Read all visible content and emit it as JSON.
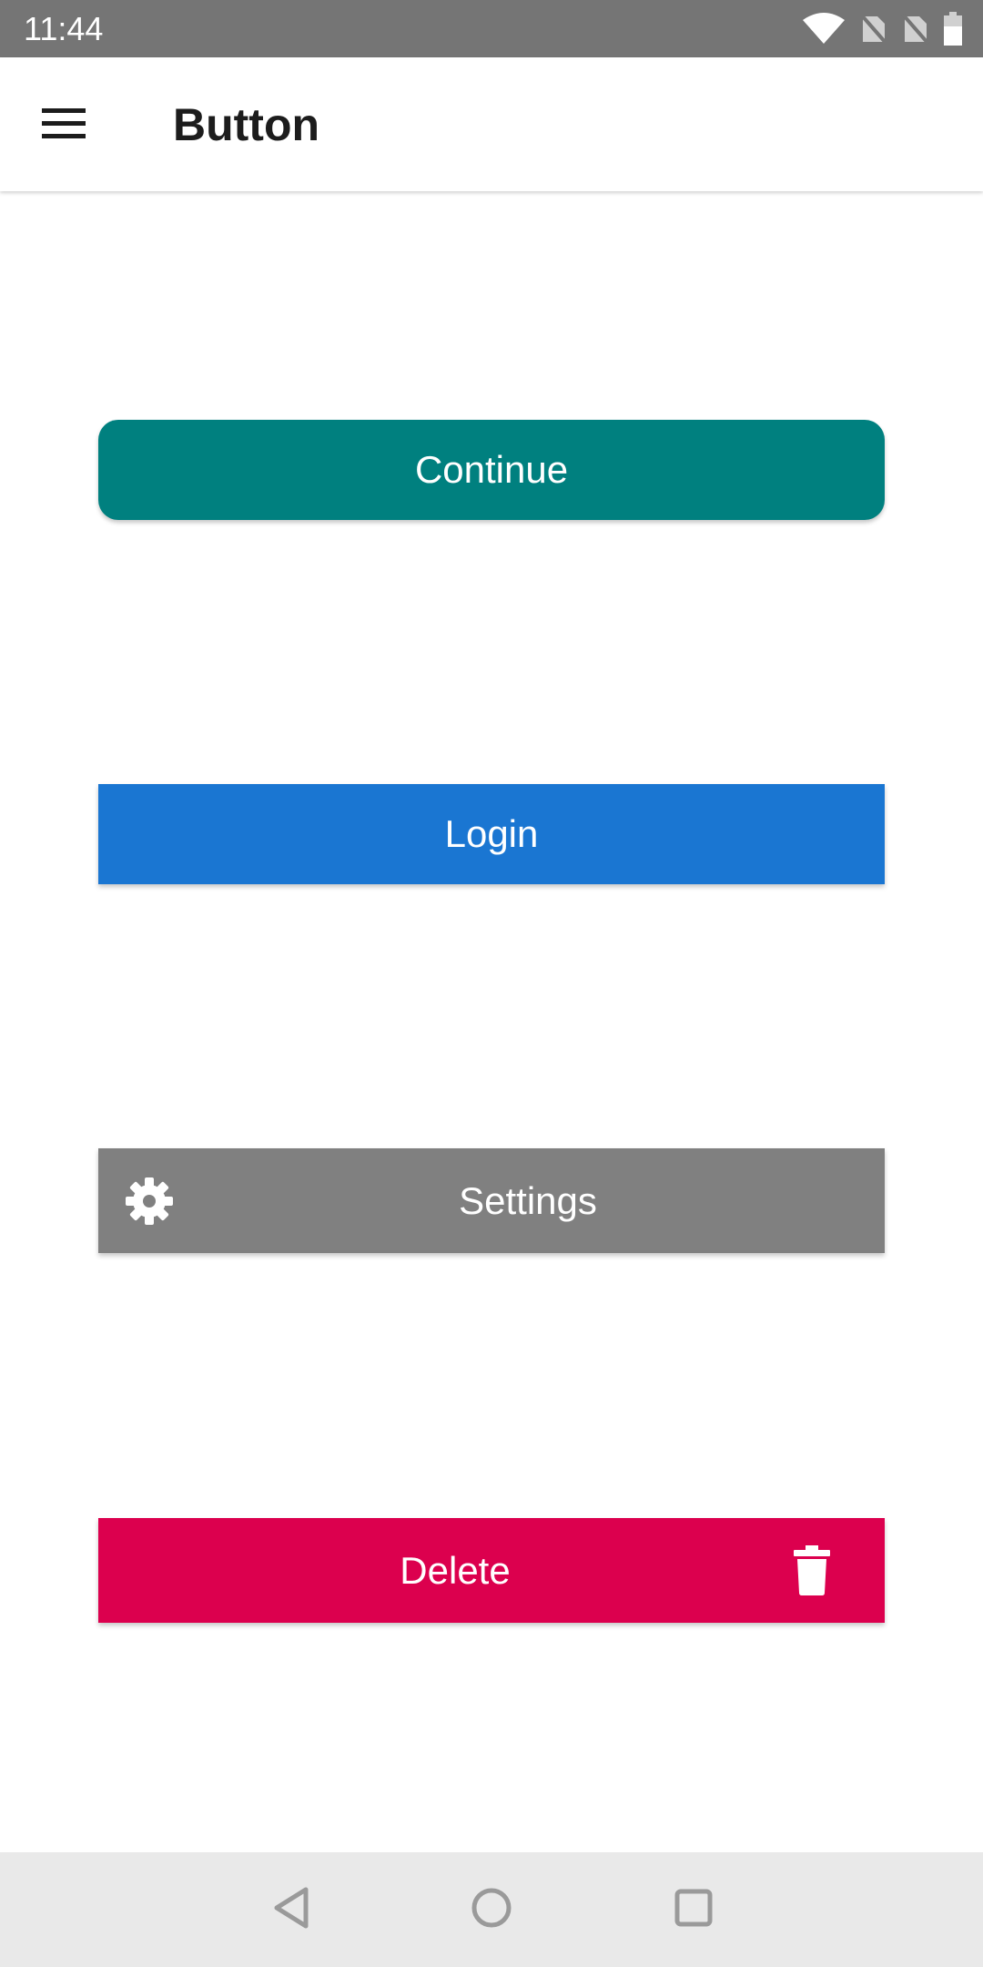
{
  "status_bar": {
    "time": "11:44",
    "icons": [
      "wifi-icon",
      "no-sim-icon",
      "no-sim-icon",
      "battery-icon"
    ]
  },
  "app_bar": {
    "menu_icon": "menu-icon",
    "title": "Button"
  },
  "buttons": {
    "continue": {
      "label": "Continue",
      "color": "#00807f"
    },
    "login": {
      "label": "Login",
      "color": "#1a76d2"
    },
    "settings": {
      "label": "Settings",
      "color": "#808080",
      "icon": "gear-icon"
    },
    "delete": {
      "label": "Delete",
      "color": "#dc004e",
      "icon": "trash-icon"
    }
  },
  "nav_bar": {
    "icons": [
      "back-icon",
      "home-icon",
      "recents-icon"
    ]
  }
}
